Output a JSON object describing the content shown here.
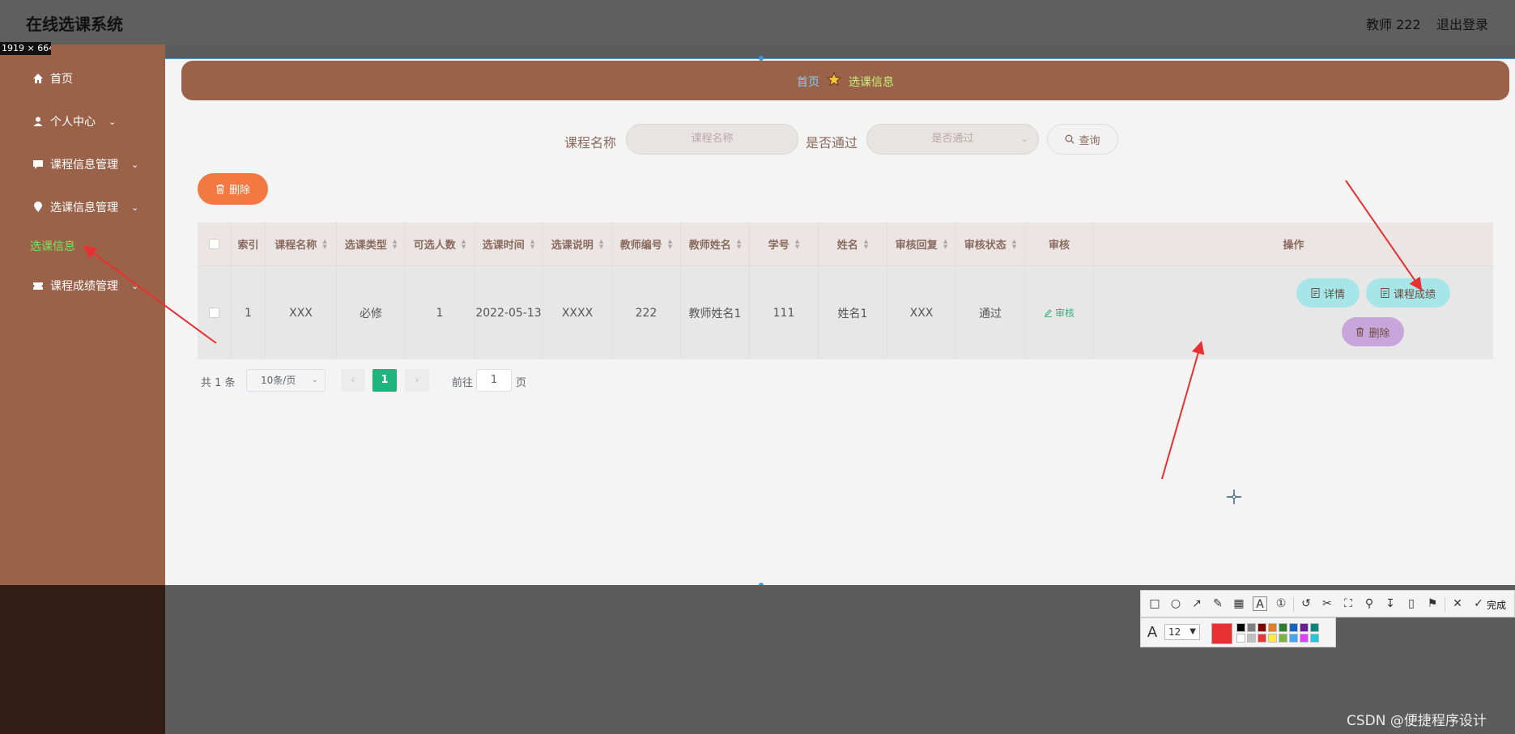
{
  "app": {
    "title": "在线选课系统",
    "user": "教师 222",
    "logout": "退出登录"
  },
  "capture_size": "1919 × 664",
  "sidebar": {
    "items": [
      {
        "label": "首页",
        "icon": "home-icon"
      },
      {
        "label": "个人中心",
        "icon": "user-icon"
      },
      {
        "label": "课程信息管理",
        "icon": "chat-icon"
      },
      {
        "label": "选课信息管理",
        "icon": "location-icon"
      },
      {
        "label": "选课信息",
        "icon": ""
      },
      {
        "label": "课程成绩管理",
        "icon": "ticket-icon"
      }
    ]
  },
  "breadcrumb": {
    "home": "首页",
    "current": "选课信息"
  },
  "search": {
    "course_label": "课程名称",
    "course_placeholder": "课程名称",
    "pass_label": "是否通过",
    "pass_placeholder": "是否通过",
    "query_button": "查询"
  },
  "toolbar": {
    "delete_button": "删除"
  },
  "table": {
    "headers": [
      "索引",
      "课程名称",
      "选课类型",
      "可选人数",
      "选课时间",
      "选课说明",
      "教师编号",
      "教师姓名",
      "学号",
      "姓名",
      "审核回复",
      "审核状态",
      "审核",
      "操作"
    ],
    "rows": [
      {
        "index": "1",
        "course_name": "XXX",
        "course_type": "必修",
        "capacity": "1",
        "time": "2022-05-13",
        "description": "XXXX",
        "teacher_id": "222",
        "teacher_name": "教师姓名1",
        "student_id": "111",
        "name": "姓名1",
        "audit_reply": "XXX",
        "audit_status": "通过",
        "audit_action": "审核",
        "actions": {
          "detail": "详情",
          "grade": "课程成绩",
          "delete": "删除"
        }
      }
    ]
  },
  "pagination": {
    "total": "共 1 条",
    "page_size": "10条/页",
    "current_page": "1",
    "goto_label": "前往",
    "goto_value": "1",
    "goto_unit": "页"
  },
  "screenshot_tool": {
    "font_size": "12",
    "done": "完成",
    "current_color": "#e83030"
  },
  "watermark": "CSDN @便捷程序设计"
}
